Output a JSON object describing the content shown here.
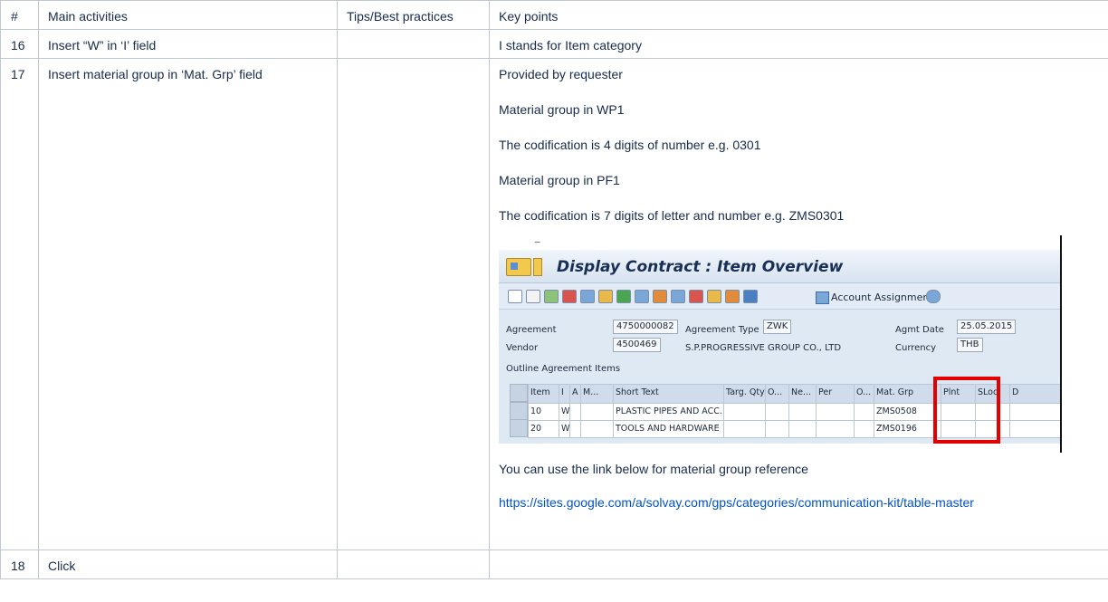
{
  "table": {
    "headers": {
      "num": "#",
      "activities": "Main activities",
      "tips": "Tips/Best practices",
      "keypoints": "Key points"
    },
    "rows": [
      {
        "num": "16",
        "activity": "Insert “W” in ‘I’ field",
        "keypoint": "I stands for Item category"
      },
      {
        "num": "17",
        "activity": "Insert material group in ‘Mat. Grp’ field",
        "keypoints_before": [
          "Provided by requester",
          "Material group in WP1",
          "The codification is 4 digits of number e.g. 0301",
          "Material group in PF1",
          "The codification is 7 digits of letter and number e.g. ZMS0301"
        ],
        "keypoint_after": "You can use the link below for material group reference",
        "link": "https://sites.google.com/a/solvay.com/gps/categories/communication-kit/table-master"
      },
      {
        "num": "18",
        "activity": "Click"
      }
    ]
  },
  "sap_screenshot": {
    "title": "Display Contract : Item Overview",
    "account_assignments": "Account Assignments",
    "fields": {
      "agreement_label": "Agreement",
      "agreement_value": "4750000082",
      "agreement_type_label": "Agreement Type",
      "agreement_type_value": "ZWK",
      "agmt_date_label": "Agmt Date",
      "agmt_date_value": "25.05.2015",
      "vendor_label": "Vendor",
      "vendor_value": "4500469",
      "vendor_name": "S.P.PROGRESSIVE GROUP CO., LTD",
      "currency_label": "Currency",
      "currency_value": "THB"
    },
    "outline_label": "Outline Agreement Items",
    "columns": [
      "Item",
      "I",
      "A",
      "M...",
      "Short Text",
      "Targ. Qty",
      "O...",
      "Ne...",
      "Per",
      "O...",
      "Mat. Grp",
      "Plnt",
      "SLoc",
      "D"
    ],
    "rows": [
      {
        "item": "10",
        "i": "W",
        "short_text": "PLASTIC PIPES AND ACC...",
        "mat_grp": "ZMS0508"
      },
      {
        "item": "20",
        "i": "W",
        "short_text": "TOOLS AND HARDWARE",
        "mat_grp": "ZMS0196"
      }
    ],
    "highlight_color": "#e20000"
  }
}
